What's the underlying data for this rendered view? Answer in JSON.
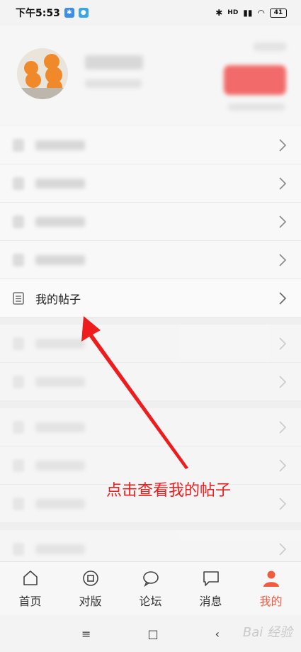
{
  "status_bar": {
    "time": "下午5:53",
    "battery": "41",
    "network": "HD"
  },
  "menu": {
    "highlighted_item_label": "我的帖子"
  },
  "annotation": {
    "text": "点击查看我的帖子",
    "color": "#ee1c1c"
  },
  "bottom_nav": {
    "items": [
      {
        "label": "首页",
        "icon": "home-icon"
      },
      {
        "label": "对版",
        "icon": "circle-square-icon"
      },
      {
        "label": "论坛",
        "icon": "chat-bubble-icon"
      },
      {
        "label": "消息",
        "icon": "message-icon"
      },
      {
        "label": "我的",
        "icon": "person-icon"
      }
    ],
    "active_index": 4,
    "active_color": "#f15b40"
  },
  "system_nav": {
    "menu_glyph": "≡",
    "home_glyph": "□",
    "back_glyph": "‹"
  },
  "watermark": "Bai 经验"
}
